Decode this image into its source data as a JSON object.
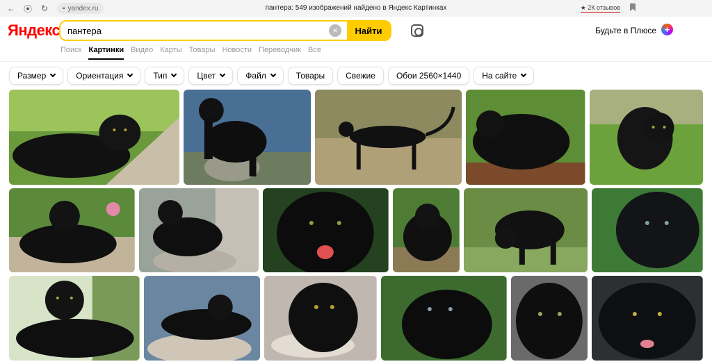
{
  "browser": {
    "url": "yandex.ru",
    "title": "пантера: 549 изображений найдено в Яндекс Картинках",
    "reviews": "★ 2К отзывов"
  },
  "header": {
    "logo": "Яндекс",
    "search_value": "пантера",
    "search_button": "Найти",
    "plus_link": "Будьте в Плюсе"
  },
  "tabs": [
    {
      "label": "Поиск"
    },
    {
      "label": "Картинки",
      "active": true
    },
    {
      "label": "Видео"
    },
    {
      "label": "Карты"
    },
    {
      "label": "Товары"
    },
    {
      "label": "Новости"
    },
    {
      "label": "Переводчик"
    },
    {
      "label": "Все"
    }
  ],
  "filters": [
    {
      "label": "Размер",
      "dropdown": true
    },
    {
      "label": "Ориентация",
      "dropdown": true
    },
    {
      "label": "Тип",
      "dropdown": true
    },
    {
      "label": "Цвет",
      "dropdown": true
    },
    {
      "label": "Файл",
      "dropdown": true
    },
    {
      "label": "Товары",
      "dropdown": false
    },
    {
      "label": "Свежие",
      "dropdown": false
    },
    {
      "label": "Обои 2560×1440",
      "dropdown": false
    },
    {
      "label": "На сайте",
      "dropdown": true
    }
  ],
  "colors": {
    "accent": "#ffcc00",
    "logo_red": "#ff0000"
  }
}
